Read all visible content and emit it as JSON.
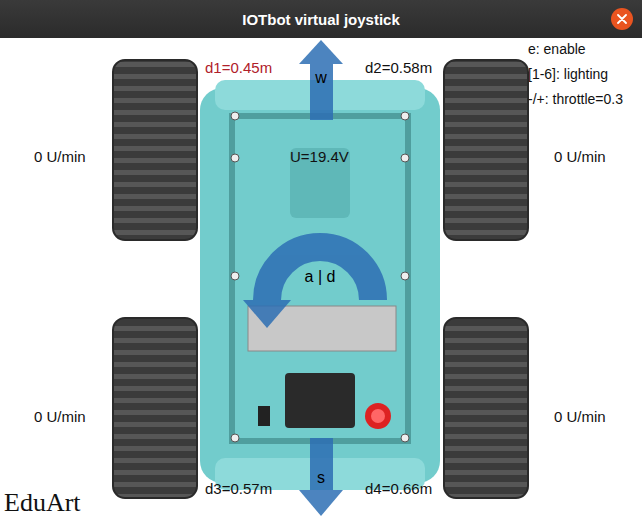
{
  "window": {
    "title": "IOTbot virtual joystick"
  },
  "distances": [
    {
      "label": "d1=0.45m",
      "color": "#b0202a"
    },
    {
      "label": "d2=0.58m",
      "color": "#111111"
    },
    {
      "label": "d3=0.57m",
      "color": "#111111"
    },
    {
      "label": "d4=0.66m",
      "color": "#111111"
    }
  ],
  "wheels": [
    {
      "speed": "0 U/min"
    },
    {
      "speed": "0 U/min"
    },
    {
      "speed": "0 U/min"
    },
    {
      "speed": "0 U/min"
    }
  ],
  "voltage": "U=19.4V",
  "help": [
    "e: enable",
    "[1-6]: lighting",
    "-/+: throttle=0.3"
  ],
  "controls": {
    "forward": "w",
    "backward": "s",
    "rotate": "a | d"
  },
  "logo": "EduArt"
}
